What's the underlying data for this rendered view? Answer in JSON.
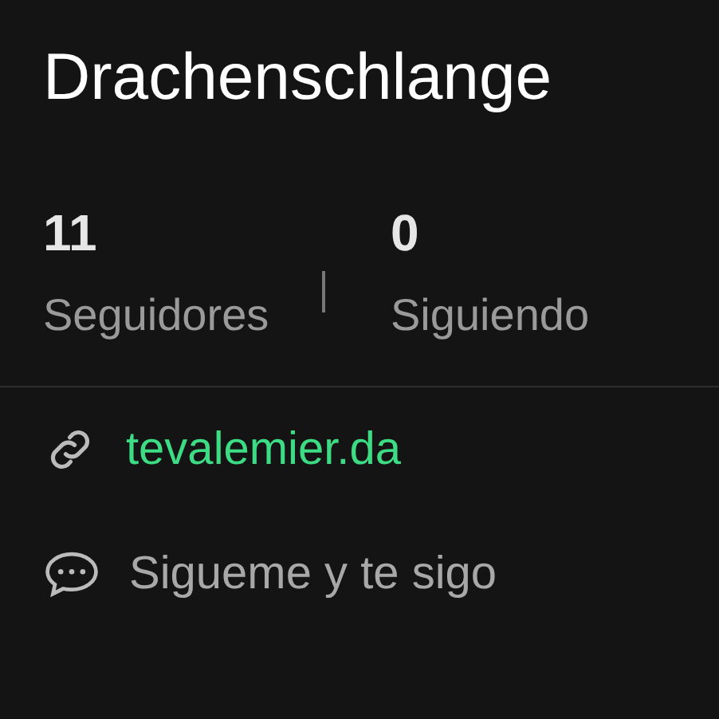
{
  "profile": {
    "name": "Drachenschlange"
  },
  "stats": [
    {
      "count": "11",
      "label": "Seguidores"
    },
    {
      "count": "0",
      "label": "Siguiendo"
    }
  ],
  "details": [
    {
      "kind": "link",
      "text": "tevalemier.da"
    },
    {
      "kind": "bio",
      "text": "Sigueme y te sigo"
    }
  ]
}
